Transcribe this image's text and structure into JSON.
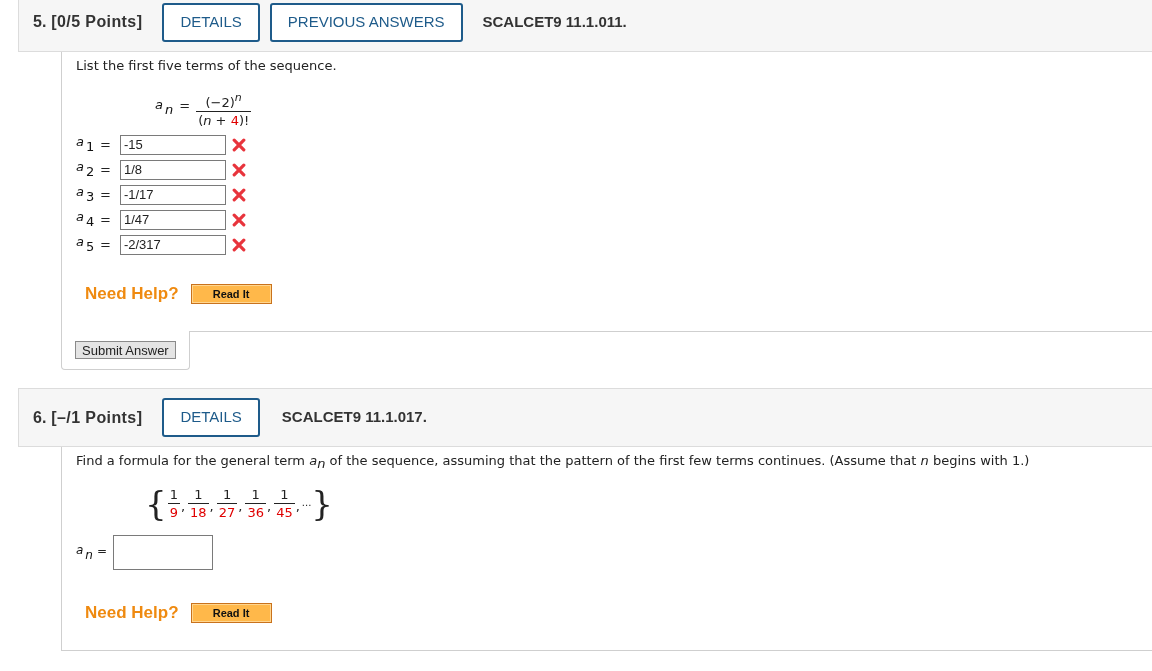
{
  "questions": [
    {
      "number": "5.",
      "points": "[0/5 Points]",
      "header_buttons": [
        "DETAILS",
        "PREVIOUS ANSWERS"
      ],
      "code": "SCALCET9 11.1.011.",
      "prompt": "List the first five terms of the sequence.",
      "formula": {
        "lhs": {
          "symbol": "a",
          "sub": [
            {
              "text": "n",
              "kind": "var"
            }
          ]
        },
        "equals": "=",
        "numerator": [
          {
            "text": "(−2)",
            "kind": "text"
          },
          {
            "text": "n",
            "kind": "sup_var"
          }
        ],
        "denominator": [
          {
            "text": "(",
            "kind": "text"
          },
          {
            "text": "n",
            "kind": "var"
          },
          {
            "text": " + ",
            "kind": "text"
          },
          {
            "text": "4",
            "kind": "param"
          },
          {
            "text": ")!",
            "kind": "text"
          }
        ]
      },
      "answers": [
        {
          "kind": "inline",
          "label": {
            "symbol": "a",
            "sub": [
              {
                "text": "1",
                "kind": "text"
              }
            ]
          },
          "equals": "=",
          "value": "-15",
          "correct": false
        },
        {
          "kind": "inline",
          "label": {
            "symbol": "a",
            "sub": [
              {
                "text": "2",
                "kind": "text"
              }
            ]
          },
          "equals": "=",
          "value": "1/8",
          "correct": false
        },
        {
          "kind": "inline",
          "label": {
            "symbol": "a",
            "sub": [
              {
                "text": "3",
                "kind": "text"
              }
            ]
          },
          "equals": "=",
          "value": "-1/17",
          "correct": false
        },
        {
          "kind": "inline",
          "label": {
            "symbol": "a",
            "sub": [
              {
                "text": "4",
                "kind": "text"
              }
            ]
          },
          "equals": "=",
          "value": "1/47",
          "correct": false
        },
        {
          "kind": "inline",
          "label": {
            "symbol": "a",
            "sub": [
              {
                "text": "5",
                "kind": "text"
              }
            ]
          },
          "equals": "=",
          "value": "-2/317",
          "correct": false
        }
      ],
      "help": {
        "label": "Need Help?",
        "buttons": [
          "Read It"
        ]
      },
      "submit": "Submit Answer"
    },
    {
      "number": "6.",
      "points": "[–/1 Points]",
      "header_buttons": [
        "DETAILS"
      ],
      "code": "SCALCET9 11.1.017.",
      "prompt": "Find a formula for the general term *a*$_{n}$ of the sequence, assuming that the pattern of the first few terms continues. (Assume that *n* begins with 1.)",
      "sequence": {
        "open": "{",
        "terms": [
          {
            "numerator": [
              {
                "text": "1",
                "kind": "text"
              }
            ],
            "denominator": [
              {
                "text": "9",
                "kind": "param"
              }
            ]
          },
          {
            "numerator": [
              {
                "text": "1",
                "kind": "text"
              }
            ],
            "denominator": [
              {
                "text": "18",
                "kind": "param"
              }
            ]
          },
          {
            "numerator": [
              {
                "text": "1",
                "kind": "text"
              }
            ],
            "denominator": [
              {
                "text": "27",
                "kind": "param"
              }
            ]
          },
          {
            "numerator": [
              {
                "text": "1",
                "kind": "text"
              }
            ],
            "denominator": [
              {
                "text": "36",
                "kind": "param"
              }
            ]
          },
          {
            "numerator": [
              {
                "text": "1",
                "kind": "text"
              }
            ],
            "denominator": [
              {
                "text": "45",
                "kind": "param"
              }
            ]
          }
        ],
        "separator": ",",
        "ellipsis": "...",
        "close": "}"
      },
      "answers": [
        {
          "kind": "block",
          "label": {
            "symbol": "a",
            "sub": [
              {
                "text": "n",
                "kind": "var"
              }
            ]
          },
          "equals": "="
        }
      ],
      "help": {
        "label": "Need Help?",
        "buttons": [
          "Read It"
        ]
      }
    }
  ]
}
